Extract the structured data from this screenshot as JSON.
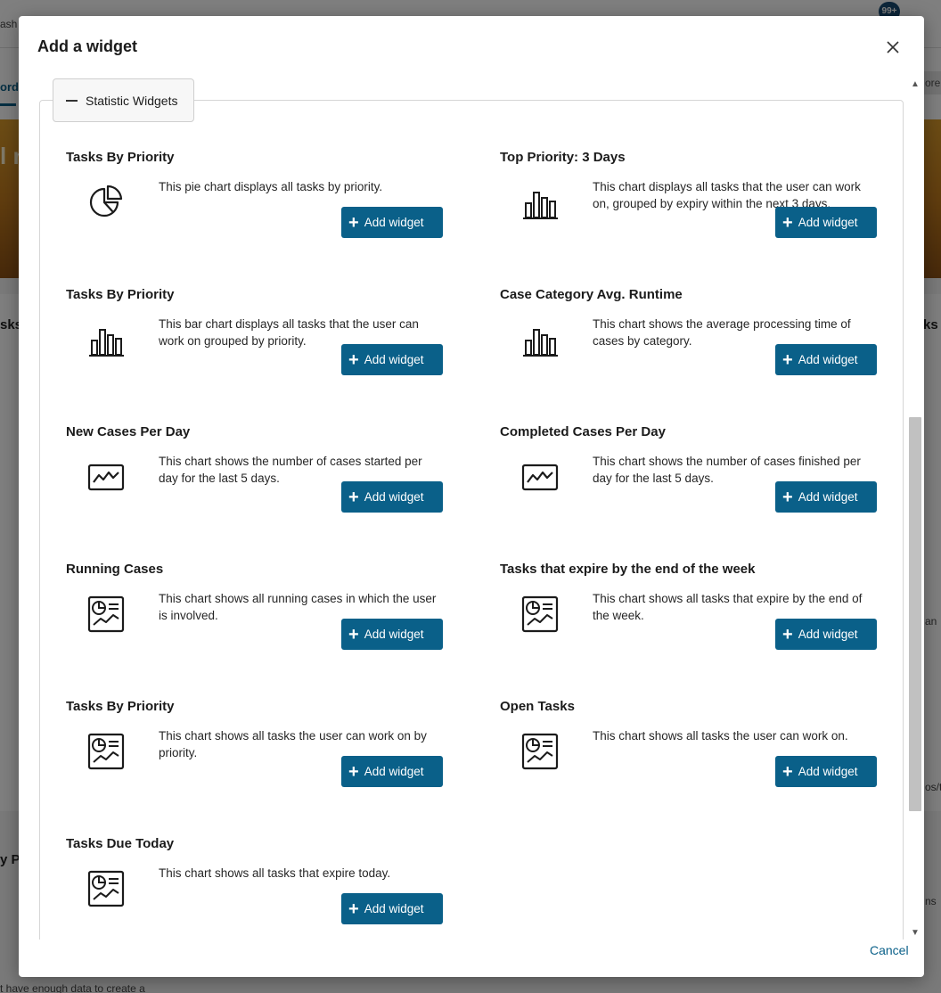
{
  "background": {
    "top_fragment": "ash",
    "badge": "99+",
    "nav_fragment": "ord",
    "nav_right_fragment": "ore",
    "banner_fragment": "l n",
    "left_fragment_1": "sks",
    "right_fragment_1": "ks",
    "left_fragment_2": "y P",
    "right_fragment_2": "an",
    "right_fragment_3": "os/t",
    "right_fragment_4": "ns",
    "bottom_fragment": "t have enough data to create a"
  },
  "dialog": {
    "title": "Add a widget",
    "close_icon": "close-icon",
    "section_label": "Statistic Widgets",
    "cancel_label": "Cancel"
  },
  "widgets": [
    {
      "title": "Tasks By Priority",
      "description": "This pie chart displays all tasks by priority.",
      "icon": "pie-chart-icon",
      "button": "Add widget"
    },
    {
      "title": "Top Priority: 3 Days",
      "description": "This chart displays all tasks that the user can work on, grouped by expiry within the next 3 days.",
      "icon": "bar-chart-icon",
      "button": "Add widget"
    },
    {
      "title": "Tasks By Priority",
      "description": "This bar chart displays all tasks that the user can work on grouped by priority.",
      "icon": "bar-chart-icon",
      "button": "Add widget"
    },
    {
      "title": "Case Category Avg. Runtime",
      "description": "This chart shows the average processing time of cases by category.",
      "icon": "bar-chart-icon",
      "button": "Add widget"
    },
    {
      "title": "New Cases Per Day",
      "description": "This chart shows the number of cases started per day for the last 5 days.",
      "icon": "line-chart-icon",
      "button": "Add widget"
    },
    {
      "title": "Completed Cases Per Day",
      "description": "This chart shows the number of cases finished per day for the last 5 days.",
      "icon": "line-chart-icon",
      "button": "Add widget"
    },
    {
      "title": "Running Cases",
      "description": "This chart shows all running cases in which the user is involved.",
      "icon": "report-chart-icon",
      "button": "Add widget"
    },
    {
      "title": "Tasks that expire by the end of the week",
      "description": "This chart shows all tasks that expire by the end of the week.",
      "icon": "report-chart-icon",
      "button": "Add widget"
    },
    {
      "title": "Tasks By Priority",
      "description": "This chart shows all tasks the user can work on by priority.",
      "icon": "report-chart-icon",
      "button": "Add widget"
    },
    {
      "title": "Open Tasks",
      "description": "This chart shows all tasks the user can work on.",
      "icon": "report-chart-icon",
      "button": "Add widget"
    },
    {
      "title": "Tasks Due Today",
      "description": "This chart shows all tasks that expire today.",
      "icon": "report-chart-icon",
      "button": "Add widget"
    }
  ],
  "colors": {
    "primary": "#0a6089",
    "text": "#1b1b1b",
    "overlay": "rgba(0,0,0,0.5)"
  }
}
